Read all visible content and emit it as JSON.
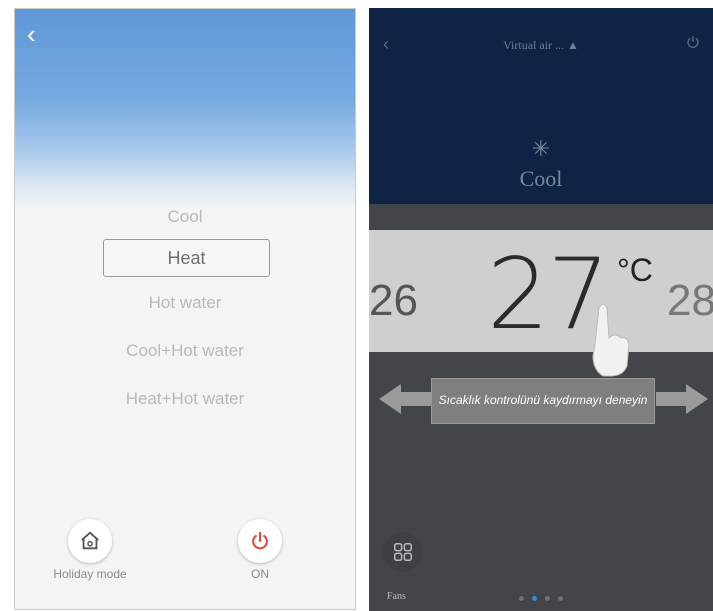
{
  "left": {
    "modes": [
      {
        "label": "Cool",
        "selected": false
      },
      {
        "label": "Heat",
        "selected": true
      },
      {
        "label": "Hot water",
        "selected": false
      },
      {
        "label": "Cool+Hot water",
        "selected": false
      },
      {
        "label": "Heat+Hot water",
        "selected": false
      }
    ],
    "holiday_label": "Holiday mode",
    "power_label": "ON",
    "colors": {
      "header_blue": "#5f98d8",
      "power_red": "#e2463d"
    }
  },
  "right": {
    "title": "Virtual air ... ▲",
    "mode_label": "Cool",
    "temperature": "27",
    "unit": "°C",
    "prev_temp": "26",
    "next_temp": "28",
    "hint": "Sıcaklık kontrolünü kaydırmayı deneyin",
    "fan_label": "Fans",
    "page_dots": 4,
    "active_dot": 1,
    "colors": {
      "header_navy": "#0f2345",
      "body_gray": "#424549",
      "band_gray": "#cfcfcf",
      "dot_active": "#3a87d6"
    }
  }
}
